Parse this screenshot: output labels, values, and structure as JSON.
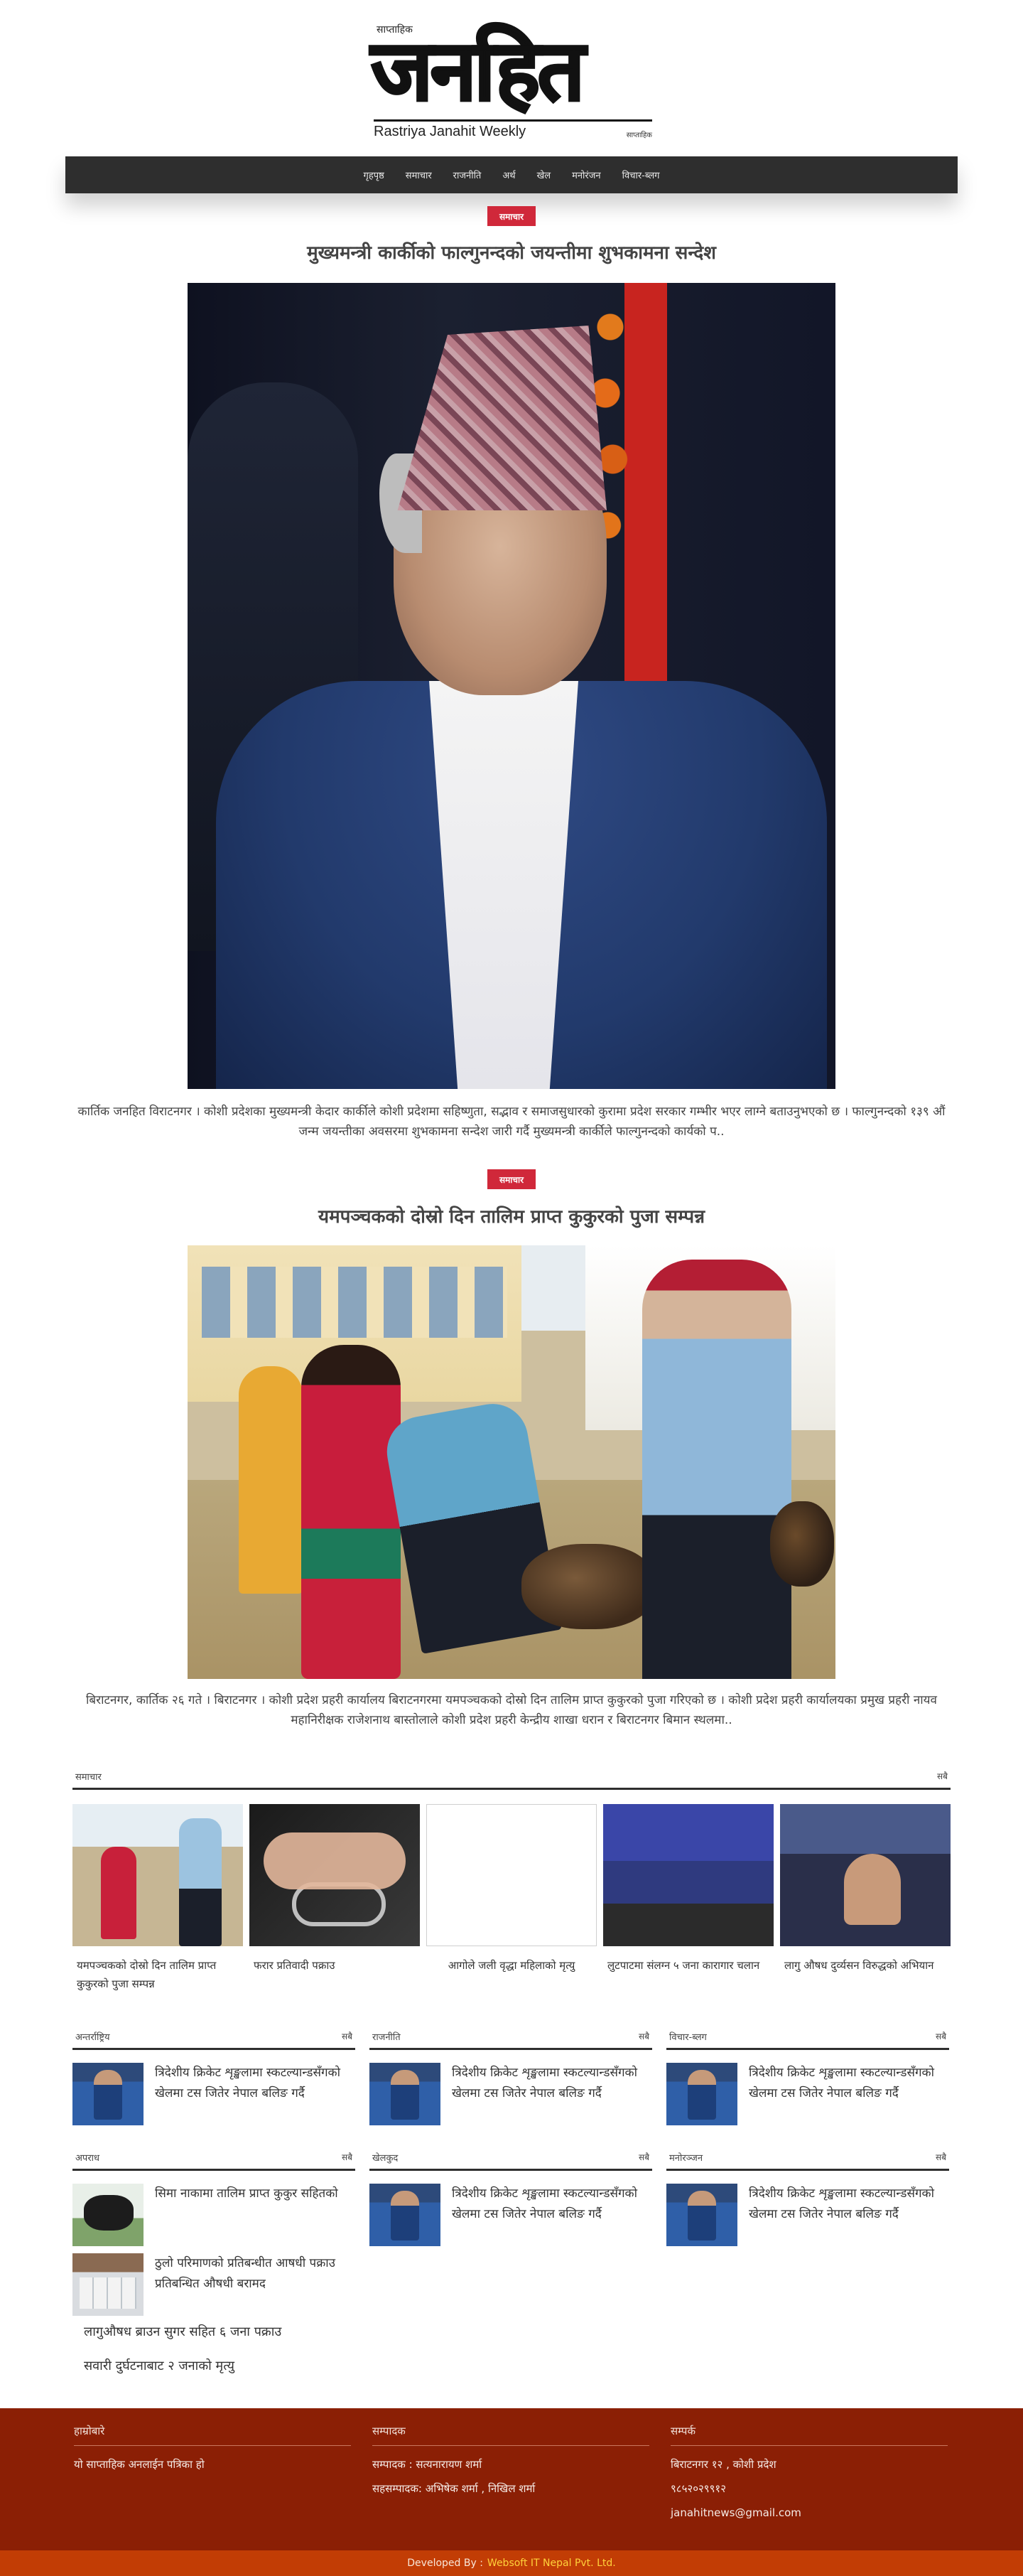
{
  "header": {
    "logo_top": "साप्ताहिक",
    "logo_text": "जनहित",
    "logo_sub": "Rastriya Janahit Weekly",
    "logo_tag": "साप्ताहिक"
  },
  "nav": [
    "गृहपृष्ठ",
    "समाचार",
    "राजनीति",
    "अर्थ",
    "खेल",
    "मनोरंजन",
    "विचार-ब्लग"
  ],
  "featured": [
    {
      "category": "समाचार",
      "title": "मुख्यमन्त्री कार्कीको फाल्गुनन्दको जयन्तीमा शुभकामना सन्देश",
      "excerpt": "कार्तिक जनहित विराटनगर । कोशी प्रदेशका मुख्यमन्त्री केदार कार्कीले कोशी प्रदेशमा सहिष्णुता, सद्भाव र समाजसुधारको कुरामा प्रदेश सरकार गम्भीर भएर लाग्ने बताउनुभएको छ । फाल्गुनन्दको १३९ औं जन्म जयन्तीका अवसरमा शुभकामना सन्देश जारी गर्दै मुख्यमन्त्री कार्कीले फाल्गुनन्दको कार्यको प.."
    },
    {
      "category": "समाचार",
      "title": "यमपञ्चकको दोस्रो दिन तालिम प्राप्त कुकुरको पुजा सम्पन्न",
      "excerpt": "बिराटनगर, कार्तिक २६ गते । बिराटनगर । कोशी प्रदेश प्रहरी कार्यालय बिराटनगरमा यमपञ्चकको दोस्रो दिन तालिम प्राप्त कुकुरको पुजा गरिएको छ । कोशी प्रदेश प्रहरी कार्यालयका प्रमुख प्रहरी नायव महानिरीक्षक राजेशनाथ बास्तोलाले कोशी प्रदेश प्रहरी केन्द्रीय शाखा धरान र बिराटनगर बिमान स्थलमा.."
    }
  ],
  "section_news": {
    "title": "समाचार",
    "more": "सबै",
    "cards": [
      {
        "title": "यमपञ्चकको दोस्रो दिन तालिम प्राप्त कुकुरको पुजा सम्पन्न"
      },
      {
        "title": "फरार प्रतिवादी पक्राउ"
      },
      {
        "title": "आगोले जली वृद्धा महिलाको मृत्यु"
      },
      {
        "title": "लुटपाटमा संलग्न ५ जना कारागार चलान"
      },
      {
        "title": "लागु औषध दुर्व्यसन विरुद्धको अभियान"
      }
    ]
  },
  "mini_sections": [
    {
      "title": "अन्तर्राष्ट्रिय",
      "more": "सबै",
      "items": [
        {
          "title": "त्रिदेशीय क्रिकेट शृङ्खलामा स्कटल्यान्डसँगको खेलमा टस जितेर नेपाल बलिङ गर्दै"
        }
      ]
    },
    {
      "title": "राजनीति",
      "more": "सबै",
      "items": [
        {
          "title": "त्रिदेशीय क्रिकेट शृङ्खलामा स्कटल्यान्डसँगको खेलमा टस जितेर नेपाल बलिङ गर्दै"
        }
      ]
    },
    {
      "title": "विचार-ब्लग",
      "more": "सबै",
      "items": [
        {
          "title": "त्रिदेशीय क्रिकेट शृङ्खलामा स्कटल्यान्डसँगको खेलमा टस जितेर नेपाल बलिङ गर्दै"
        }
      ]
    },
    {
      "title": "अपराध",
      "more": "सबै",
      "items": [
        {
          "title": "सिमा नाकामा तालिम प्राप्त कुकुर सहितको"
        },
        {
          "title": "ठुलो परिमाणको प्रतिबन्धीत आषधी पक्राउ प्रतिबन्धित औषधी बरामद"
        }
      ],
      "links": [
        "लागुऔषध ब्राउन सुगर सहित ६ जना पक्राउ",
        "सवारी दुर्घटनाबाट २ जनाको मृत्यु"
      ]
    },
    {
      "title": "खेलकुद",
      "more": "सबै",
      "items": [
        {
          "title": "त्रिदेशीय क्रिकेट शृङ्खलामा स्कटल्यान्डसँगको खेलमा टस जितेर नेपाल बलिङ गर्दै"
        }
      ]
    },
    {
      "title": "मनोरञ्जन",
      "more": "सबै",
      "items": [
        {
          "title": "त्रिदेशीय क्रिकेट शृङ्खलामा स्कटल्यान्डसँगको खेलमा टस जितेर नेपाल बलिङ गर्दै"
        }
      ]
    }
  ],
  "footer": {
    "col1": {
      "title": "हाम्रोबारे",
      "lines": [
        "यो साप्ताहिक अनलाईन पत्रिका हो"
      ]
    },
    "col2": {
      "title": "सम्पादक",
      "lines": [
        "सम्पादक : सत्यनारायण शर्मा",
        "सहसम्पादक: अभिषेक शर्मा , निखिल शर्मा"
      ]
    },
    "col3": {
      "title": "सम्पर्क",
      "lines": [
        "बिराटनगर १२ , कोशी प्रदेश",
        "९८५२०२९९१२",
        "janahitnews@gmail.com"
      ]
    },
    "bar_label": "Developed By :",
    "bar_credit": "Websoft IT Nepal Pvt. Ltd."
  }
}
